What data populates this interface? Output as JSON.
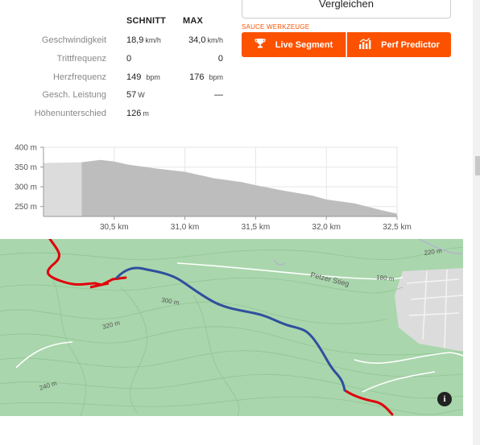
{
  "stats": {
    "col_avg": "SCHNITT",
    "col_max": "MAX",
    "rows": [
      {
        "label": "Geschwindigkeit",
        "avg": "18,9",
        "avg_unit": "km/h",
        "max": "34,0",
        "max_unit": "km/h"
      },
      {
        "label": "Trittfrequenz",
        "avg": "0",
        "avg_unit": "",
        "max": "0",
        "max_unit": ""
      },
      {
        "label": "Herzfrequenz",
        "avg": "149",
        "avg_unit": "bpm",
        "max": "176",
        "max_unit": "bpm"
      },
      {
        "label": "Gesch. Leistung",
        "avg": "57",
        "avg_unit": "W",
        "max": "—",
        "max_unit": ""
      },
      {
        "label": "Höhenunterschied",
        "avg": "126",
        "avg_unit": "m",
        "max": "",
        "max_unit": ""
      }
    ]
  },
  "compare_label": "Vergleichen",
  "sauce": {
    "title": "SAUCE WERKZEUGE",
    "live_label": "Live Segment",
    "perf_label": "Perf Predictor",
    "accent": "#fc5200"
  },
  "chart_data": {
    "type": "area",
    "x": [
      30.27,
      30.4,
      30.5,
      30.6,
      30.8,
      31.0,
      31.2,
      31.4,
      31.5,
      31.7,
      31.9,
      32.0,
      32.2,
      32.4,
      32.5
    ],
    "y": [
      362,
      368,
      364,
      356,
      346,
      338,
      322,
      312,
      304,
      290,
      278,
      268,
      258,
      240,
      232
    ],
    "xlim": [
      30.0,
      32.5
    ],
    "ylim": [
      225,
      400
    ],
    "x_ticks": [
      "30,5 km",
      "31,0 km",
      "31,5 km",
      "32,0 km",
      "32,5 km"
    ],
    "x_tick_values": [
      30.5,
      31.0,
      31.5,
      32.0,
      32.5
    ],
    "y_ticks": [
      "400 m",
      "350 m",
      "300 m",
      "250 m"
    ],
    "y_tick_values": [
      400,
      350,
      300,
      250
    ],
    "grid": true,
    "fill_color": "#bdbdbd",
    "context_fill_color": "#dcdcdc"
  },
  "map": {
    "labels": [
      "Petzer Stieg",
      "220 m",
      "180 m",
      "300 m",
      "320 m",
      "240 m"
    ],
    "route_highlight_color": "#2f4f9e",
    "route_color": "#e0000b",
    "info_label": "i"
  }
}
